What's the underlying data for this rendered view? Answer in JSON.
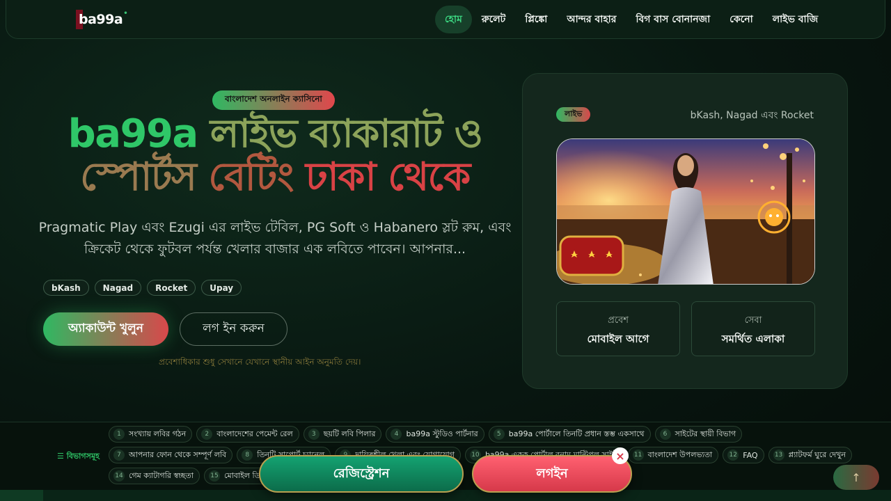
{
  "header": {
    "logo_text": "ba99a",
    "nav": [
      {
        "label": "হোম",
        "active": true
      },
      {
        "label": "রুলেট"
      },
      {
        "label": "প্লিঙ্কো"
      },
      {
        "label": "আন্দর বাহার"
      },
      {
        "label": "বিগ বাস বোনানজা"
      },
      {
        "label": "কেনো"
      },
      {
        "label": "লাইভ বাজি"
      }
    ]
  },
  "hero": {
    "badge": "বাংলাদেশ অনলাইন ক্যাসিনো",
    "title_parts": [
      "ba99a",
      "লাইভ ব্যাকারাট ও",
      "স্পোর্টস",
      "বেটিং",
      "ঢাকা থেকে"
    ],
    "description": "Pragmatic Play এবং Ezugi এর লাইভ টেবিল, PG Soft ও Habanero স্লট রুম, এবং ক্রিকেট থেকে ফুটবল পর্যন্ত খেলার বাজার এক লবিতে পাবেন। আপনার...",
    "payments": [
      "bKash",
      "Nagad",
      "Rocket",
      "Upay"
    ],
    "primary_button": "অ্যাকাউন্ট খুলুন",
    "secondary_button": "লগ ইন করুন",
    "disclaimer": "প্রবেশাধিকার শুধু সেখানে যেখানে স্থানীয় আইন অনুমতি দেয়।"
  },
  "card": {
    "badge": "লাইভ",
    "payments_text": "bKash, Nagad এবং Rocket",
    "stats": [
      {
        "label": "প্রবেশ",
        "value": "মোবাইল আগে"
      },
      {
        "label": "সেবা",
        "value": "সমর্থিত এলাকা"
      }
    ]
  },
  "categories": {
    "label": "বিভাগসমূহ",
    "row1": [
      {
        "num": "1",
        "text": "সংখ্যায় লবির গঠন"
      },
      {
        "num": "2",
        "text": "বাংলাদেশের পেমেন্ট রেল"
      },
      {
        "num": "3",
        "text": "ছয়টি লবি পিলার"
      },
      {
        "num": "4",
        "text": "ba99a স্টুডিও পার্টনার"
      },
      {
        "num": "5",
        "text": "ba99a পোর্টালে তিনটি প্রধান স্তম্ভ একসাথে"
      },
      {
        "num": "6",
        "text": "সাইটের স্থায়ী বিভাগ"
      }
    ],
    "row2": [
      {
        "num": "7",
        "text": "আপনার ফোন থেকে সম্পূর্ণ লবি"
      },
      {
        "num": "8",
        "text": "তিনটি সাপোর্ট চ্যানেল"
      },
      {
        "num": "9",
        "text": "দায়িত্বশীল খেলা এবং যোগাযোগ"
      },
      {
        "num": "10",
        "text": "ba99a একক পোর্টাল বনাম মাল্টিপল সাইট"
      },
      {
        "num": "11",
        "text": "বাংলাদেশ উপলভ্যতা"
      },
      {
        "num": "12",
        "text": "FAQ"
      },
      {
        "num": "13",
        "text": "প্ল্যাটফর্ম ঘুরে দেখুন"
      }
    ],
    "row3": [
      {
        "num": "14",
        "text": "গেম ক্যাটাগরি স্বচ্ছতা"
      },
      {
        "num": "15",
        "text": "মোবাইল ডিভাইস"
      }
    ]
  },
  "floating": {
    "primary": "রেজিস্ট্রেশন",
    "secondary": "লগইন",
    "close": "×",
    "to_top": "↑"
  },
  "colors": {
    "green": "#2fc768",
    "red": "#d94245",
    "bg": "#081610"
  }
}
